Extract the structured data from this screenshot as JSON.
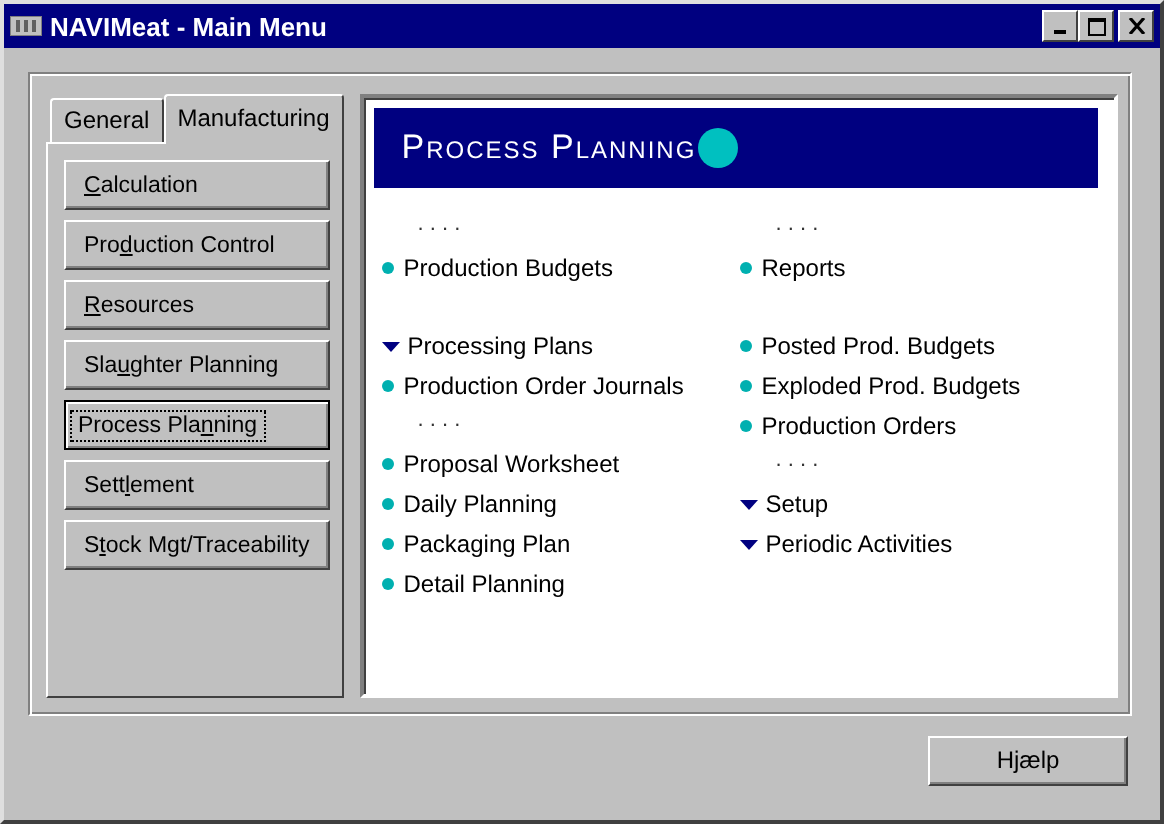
{
  "window": {
    "title": "NAVIMeat - Main Menu"
  },
  "tabs": [
    {
      "label": "General",
      "selected": false
    },
    {
      "label": "Manufacturing",
      "selected": true
    }
  ],
  "menu_buttons": [
    {
      "label": {
        "key": "C",
        "after": "alculation"
      },
      "selected": false
    },
    {
      "label": {
        "before": "Pro",
        "key": "d",
        "after": "uction Control"
      },
      "selected": false
    },
    {
      "label": {
        "key": "R",
        "after": "esources"
      },
      "selected": false
    },
    {
      "label": {
        "before": "Sla",
        "key": "u",
        "after": "ghter Planning"
      },
      "selected": false
    },
    {
      "label": {
        "before": "Process Pla",
        "key": "n",
        "after": "ning"
      },
      "selected": true
    },
    {
      "label": {
        "before": "Sett",
        "key": "l",
        "after": "ement"
      },
      "selected": false
    },
    {
      "label": {
        "before": "S",
        "key": "t",
        "after": "ock Mgt/Traceability"
      },
      "selected": false
    }
  ],
  "content": {
    "title": "Process Planning",
    "columns": [
      [
        [
          {
            "kind": "separator",
            "text": ". . . ."
          },
          {
            "kind": "bullet",
            "text": "Production Budgets"
          }
        ],
        [
          {
            "kind": "arrow",
            "text": "Processing Plans"
          },
          {
            "kind": "bullet",
            "text": "Production Order Journals"
          },
          {
            "kind": "separator",
            "text": ". . . ."
          },
          {
            "kind": "bullet",
            "text": "Proposal Worksheet"
          },
          {
            "kind": "bullet",
            "text": "Daily Planning"
          },
          {
            "kind": "bullet",
            "text": "Packaging Plan"
          },
          {
            "kind": "bullet",
            "text": "Detail Planning"
          }
        ]
      ],
      [
        [
          {
            "kind": "separator",
            "text": ". . . ."
          },
          {
            "kind": "bullet",
            "text": "Reports"
          }
        ],
        [
          {
            "kind": "bullet",
            "text": "Posted Prod. Budgets"
          },
          {
            "kind": "bullet",
            "text": "Exploded Prod. Budgets"
          },
          {
            "kind": "bullet",
            "text": "Production Orders"
          },
          {
            "kind": "separator",
            "text": ". . . ."
          },
          {
            "kind": "arrow",
            "text": "Setup"
          },
          {
            "kind": "arrow",
            "text": "Periodic Activities"
          }
        ]
      ]
    ]
  },
  "buttons": [
    "Hjælp"
  ]
}
